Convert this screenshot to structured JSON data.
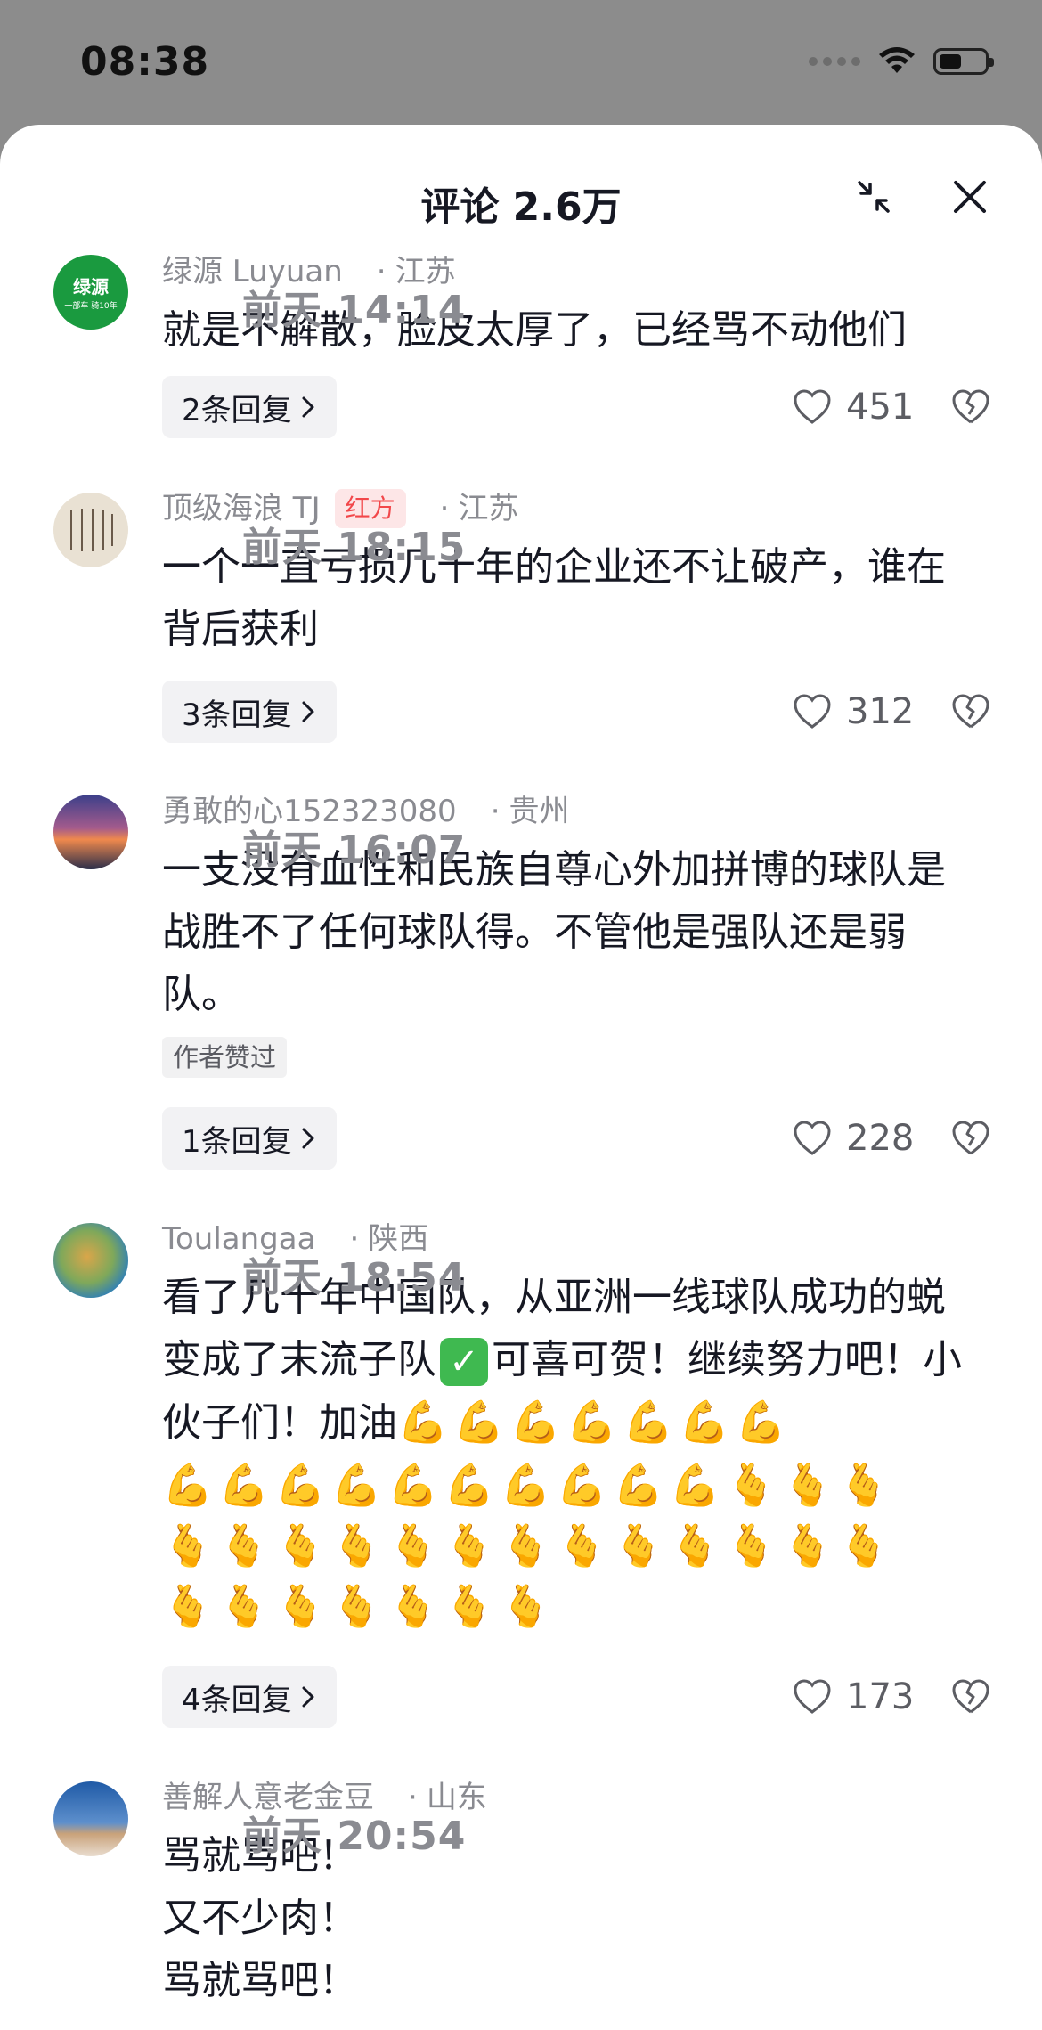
{
  "status_bar": {
    "time": "08:38"
  },
  "header": {
    "title": "评论 2.6万"
  },
  "comments": [
    {
      "user": "绿源 Luyuan",
      "time": "前天 14:14",
      "location": "江苏",
      "text": "就是不解散，脸皮太厚了，已经骂不动他们",
      "avatar_text": "绿源",
      "avatar_subtext": "一部车 骑10年",
      "reply_label": "2条回复",
      "likes": "451"
    },
    {
      "user": "顶级海浪 TJ",
      "badge": "红方",
      "time": "前天 18:15",
      "location": "江苏",
      "text": "一个一直亏损几十年的企业还不让破产，谁在背后获利",
      "reply_label": "3条回复",
      "likes": "312"
    },
    {
      "user": "勇敢的心152323080",
      "time": "前天 16:07",
      "location": "贵州",
      "text": "一支没有血性和民族自尊心外加拼博的球队是战胜不了任何球队得。不管他是强队还是弱队。",
      "tag": "作者赞过",
      "reply_label": "1条回复",
      "likes": "228"
    },
    {
      "user": "Toulangaa",
      "time": "前天 18:54",
      "location": "陕西",
      "text_part1": "看了几十年中国队，从亚洲一线球队成功的蜕变成了末流子队",
      "check_emoji": "✓",
      "text_part2": "可喜可贺！继续努力吧！小伙子们！加油",
      "emoji_line1": "💪💪💪💪💪💪💪",
      "emoji_line2": "💪💪💪💪💪💪💪💪💪💪🫰🫰🫰",
      "emoji_line3": "🫰🫰🫰🫰🫰🫰🫰🫰🫰🫰🫰🫰🫰",
      "emoji_line4": "🫰🫰🫰🫰🫰🫰🫰",
      "reply_label": "4条回复",
      "likes": "173"
    },
    {
      "user": "善解人意老金豆",
      "time": "前天 20:54",
      "location": "山东",
      "text": "骂就骂吧！\n又不少肉！\n骂就骂吧！"
    }
  ],
  "meta_separator": "·",
  "colors": {
    "accent_red": "#f2474a",
    "brand_green": "#1a9a3f",
    "muted": "#8a8b91"
  }
}
